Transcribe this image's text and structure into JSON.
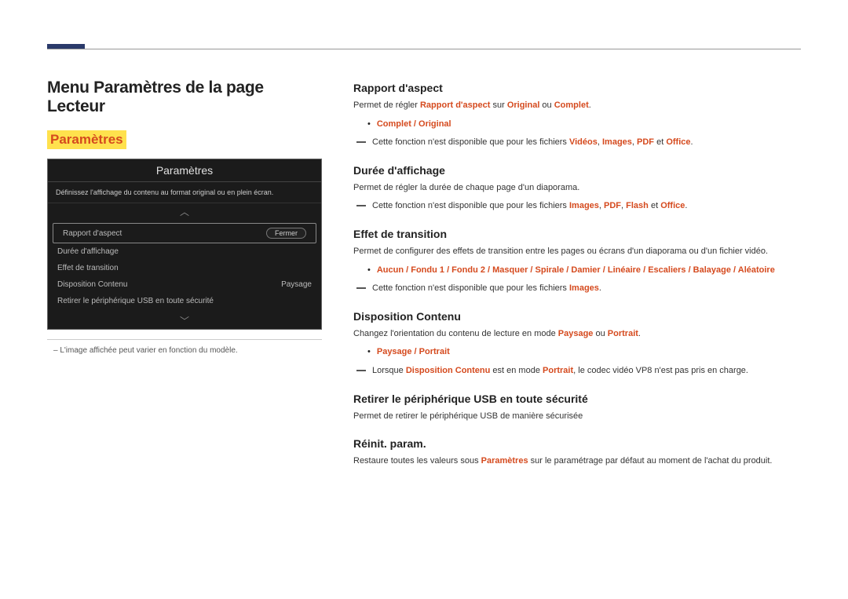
{
  "page_title": "Menu Paramètres de la page Lecteur",
  "highlight": "Paramètres",
  "ui": {
    "header": "Paramètres",
    "subtitle": "Définissez l'affichage du contenu au format original ou en plein écran.",
    "rows": [
      {
        "label": "Rapport d'aspect",
        "value": "",
        "btn": "Fermer",
        "selected": true
      },
      {
        "label": "Durée d'affichage",
        "value": ""
      },
      {
        "label": "Effet de transition",
        "value": ""
      },
      {
        "label": "Disposition Contenu",
        "value": "Paysage"
      },
      {
        "label": "Retirer le périphérique USB en toute sécurité",
        "value": ""
      }
    ]
  },
  "footnote": "– L'image affichée peut varier en fonction du modèle.",
  "sections": {
    "rapport": {
      "title": "Rapport d'aspect",
      "body_pre": "Permet de régler ",
      "body_b1": "Rapport d'aspect",
      "body_mid": " sur ",
      "body_b2": "Original",
      "body_or": " ou ",
      "body_b3": "Complet",
      "body_end": ".",
      "bullet": "Complet / Original",
      "dash_pre": "Cette fonction n'est disponible que pour les fichiers ",
      "dash_v": "Vidéos",
      "dash_i": "Images",
      "dash_p": "PDF",
      "dash_and": " et ",
      "dash_o": "Office",
      "dash_end": "."
    },
    "duree": {
      "title": "Durée d'affichage",
      "body": "Permet de régler la durée de chaque page d'un diaporama.",
      "dash_pre": "Cette fonction n'est disponible que pour les fichiers ",
      "d1": "Images",
      "d2": "PDF",
      "d3": "Flash",
      "d_and": " et ",
      "d4": "Office",
      "dend": "."
    },
    "effet": {
      "title": "Effet de transition",
      "body": "Permet de configurer des effets de transition entre les pages ou écrans d'un diaporama ou d'un fichier vidéo.",
      "bullet": "Aucun / Fondu 1 / Fondu 2 / Masquer / Spirale / Damier / Linéaire / Escaliers / Balayage / Aléatoire",
      "dash_pre": "Cette fonction n'est disponible que pour les fichiers ",
      "dimg": "Images",
      "dend": "."
    },
    "dispo": {
      "title": "Disposition Contenu",
      "body_pre": "Changez l'orientation du contenu de lecture en mode ",
      "b1": "Paysage",
      "or": " ou ",
      "b2": "Portrait",
      "end": ".",
      "bullet": "Paysage / Portrait",
      "dash_pre": "Lorsque ",
      "d1": "Disposition Contenu",
      "dmid": " est en mode ",
      "d2": "Portrait",
      "dpost": ", le codec vidéo VP8 n'est pas pris en charge."
    },
    "usb": {
      "title": "Retirer le périphérique USB en toute sécurité",
      "body": "Permet de retirer le périphérique USB de manière sécurisée"
    },
    "reinit": {
      "title": "Réinit. param.",
      "body_pre": "Restaure toutes les valeurs sous ",
      "b1": "Paramètres",
      "body_post": " sur le paramétrage par défaut au moment de l'achat du produit."
    }
  }
}
